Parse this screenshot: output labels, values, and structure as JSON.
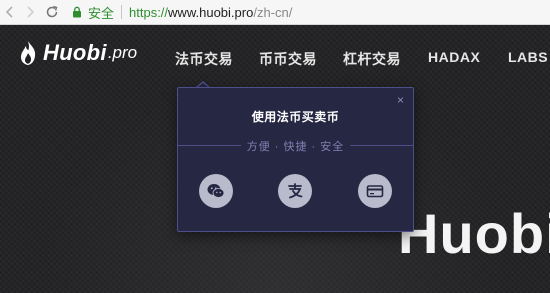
{
  "browser": {
    "secure_label": "安全",
    "url_scheme": "https://",
    "url_host": "www.huobi.pro",
    "url_path": "/zh-cn/"
  },
  "logo": {
    "main": "Huobi",
    "sub": ".pro"
  },
  "nav": {
    "items": [
      {
        "label": "法币交易"
      },
      {
        "label": "币币交易"
      },
      {
        "label": "杠杆交易"
      },
      {
        "label": "HADAX"
      },
      {
        "label": "LABS"
      }
    ]
  },
  "dropdown": {
    "title": "使用法币买卖币",
    "subtitle": "方便 · 快捷 · 安全",
    "close": "×",
    "payment_icons": [
      "wechat-pay-icon",
      "alipay-icon",
      "bank-card-icon"
    ]
  },
  "hero": {
    "text": "Huobi"
  },
  "colors": {
    "popup_bg": "#262743",
    "popup_border": "#4d4f8b",
    "page_bg": "#222224",
    "secure_green": "#2f8f2f"
  }
}
